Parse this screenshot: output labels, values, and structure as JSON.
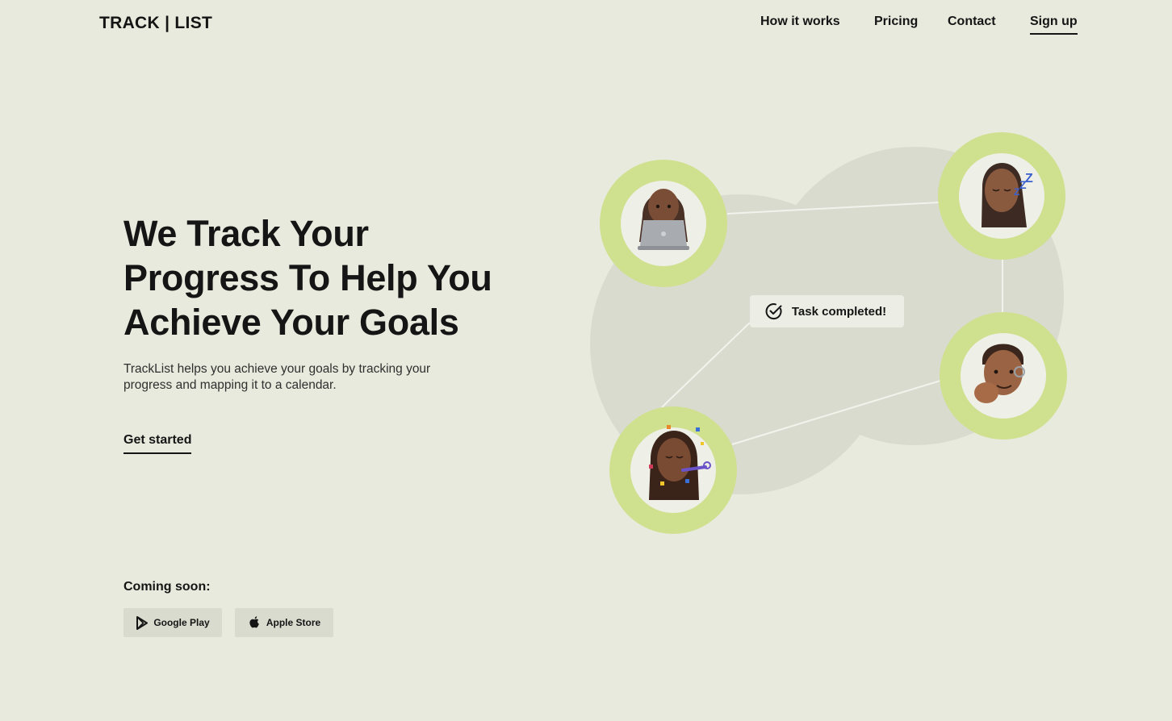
{
  "brand": {
    "logo": "TRACK | LIST"
  },
  "nav": {
    "how": "How it works",
    "pricing": "Pricing",
    "contact": "Contact",
    "signup": "Sign up"
  },
  "hero": {
    "title_lines": [
      "We Track Your",
      "Progress To Help You",
      "Achieve Your Goals"
    ],
    "subtitle": "TrackList helps you achieve your goals by tracking your progress and mapping it to a calendar.",
    "cta": "Get started"
  },
  "coming_soon": {
    "label": "Coming soon:",
    "stores": [
      {
        "label": "Google Play",
        "icon": "google-play-icon"
      },
      {
        "label": "Apple Store",
        "icon": "apple-icon"
      }
    ]
  },
  "illustration": {
    "toast": {
      "label": "Task completed!",
      "icon": "check-circle-icon"
    },
    "avatars": [
      {
        "name": "avatar-laptop",
        "icon": "memoji-laptop"
      },
      {
        "name": "avatar-sleeping",
        "icon": "memoji-sleeping"
      },
      {
        "name": "avatar-fist-bump",
        "icon": "memoji-fist-bump"
      },
      {
        "name": "avatar-celebrating",
        "icon": "memoji-party"
      }
    ],
    "colors": {
      "ring": "#cfe08f",
      "blob": "#d9dbcf",
      "bg": "#e8eadd",
      "lines": "#f4f5ee"
    }
  }
}
